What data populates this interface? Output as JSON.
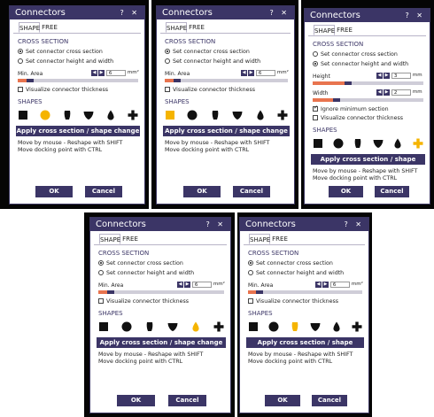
{
  "colors": {
    "title_bar": "#3b3566",
    "button": "#3b3566",
    "highlight_shape": "#f5b400",
    "shape_default": "#111111",
    "bar_orange": "#e8744f",
    "screen_bg": "#050505"
  },
  "dialogs": [
    {
      "title": "Connectors",
      "controls": "? ✕",
      "tabs": [
        "SHAPE",
        "FREE"
      ],
      "active_tab": 0,
      "section_cross": "CROSS SECTION",
      "radio1": "Set connector cross section",
      "radio2": "Set connector height and width",
      "selected_radio": 1,
      "params": [
        {
          "label": "Min. Area",
          "value": "6",
          "unit": "mm²",
          "slider": 0.13
        }
      ],
      "ignore_min": null,
      "visualize": "Visualize connector thickness",
      "section_shapes": "SHAPES",
      "highlight_index": 1,
      "apply": "Apply cross section / shape change",
      "hint1": "Move by mouse - Reshape with SHIFT",
      "hint2": "Move docking point with CTRL",
      "ok": "OK",
      "cancel": "Cancel"
    },
    {
      "title": "Connectors",
      "controls": "? ✕",
      "tabs": [
        "SHAPE",
        "FREE"
      ],
      "active_tab": 0,
      "section_cross": "CROSS SECTION",
      "radio1": "Set connector cross section",
      "radio2": "Set connector height and width",
      "selected_radio": 1,
      "params": [
        {
          "label": "Min. Area",
          "value": "6",
          "unit": "mm²",
          "slider": 0.13
        }
      ],
      "ignore_min": null,
      "visualize": "Visualize connector thickness",
      "section_shapes": "SHAPES",
      "highlight_index": 0,
      "apply": "Apply cross section / shape change",
      "hint1": "Move by mouse - Reshape with SHIFT",
      "hint2": "Move docking point with CTRL",
      "ok": "OK",
      "cancel": "Cancel"
    },
    {
      "title": "Connectors",
      "controls": "? ✕",
      "tabs": [
        "SHAPE",
        "FREE"
      ],
      "active_tab": 0,
      "section_cross": "CROSS SECTION",
      "radio1": "Set connector cross section",
      "radio2": "Set connector height and width",
      "selected_radio": 2,
      "params": [
        {
          "label": "Height",
          "value": "3",
          "unit": "mm",
          "slider": 0.35
        },
        {
          "label": "Width",
          "value": "2",
          "unit": "mm",
          "slider": 0.25
        }
      ],
      "ignore_min": "Ignore minimum section",
      "visualize": "Visualize connector thickness",
      "section_shapes": "SHAPES",
      "highlight_index": 5,
      "apply": "Apply cross section / shape change",
      "hint1": "Move by mouse - Reshape with SHIFT",
      "hint2": "Move docking point with CTRL",
      "ok": "OK",
      "cancel": "Cancel"
    },
    {
      "title": "Connectors",
      "controls": "? ✕",
      "tabs": [
        "SHAPE",
        "FREE"
      ],
      "active_tab": 0,
      "section_cross": "CROSS SECTION",
      "radio1": "Set connector cross section",
      "radio2": "Set connector height and width",
      "selected_radio": 1,
      "params": [
        {
          "label": "Min. Area",
          "value": "6",
          "unit": "mm²",
          "slider": 0.13
        }
      ],
      "ignore_min": null,
      "visualize": "Visualize connector thickness",
      "section_shapes": "SHAPES",
      "highlight_index": 4,
      "apply": "Apply cross section / shape change",
      "hint1": "Move by mouse - Reshape with SHIFT",
      "hint2": "Move docking point with CTRL",
      "ok": "OK",
      "cancel": "Cancel"
    },
    {
      "title": "Connectors",
      "controls": "? ✕",
      "tabs": [
        "SHAPE",
        "FREE"
      ],
      "active_tab": 0,
      "section_cross": "CROSS SECTION",
      "radio1": "Set connector cross section",
      "radio2": "Set connector height and width",
      "selected_radio": 1,
      "params": [
        {
          "label": "Min. Area",
          "value": "6",
          "unit": "mm²",
          "slider": 0.13
        }
      ],
      "ignore_min": null,
      "visualize": "Visualize connector thickness",
      "section_shapes": "SHAPES",
      "highlight_index": 2,
      "apply": "Apply cross section / shape change",
      "hint1": "Move by mouse - Reshape with SHIFT",
      "hint2": "Move docking point with CTRL",
      "ok": "OK",
      "cancel": "Cancel"
    }
  ],
  "shape_icons": [
    "square-shape-icon",
    "circle-shape-icon",
    "bullet-shape-icon",
    "shield-shape-icon",
    "drop-shape-icon",
    "cross-shape-icon"
  ]
}
